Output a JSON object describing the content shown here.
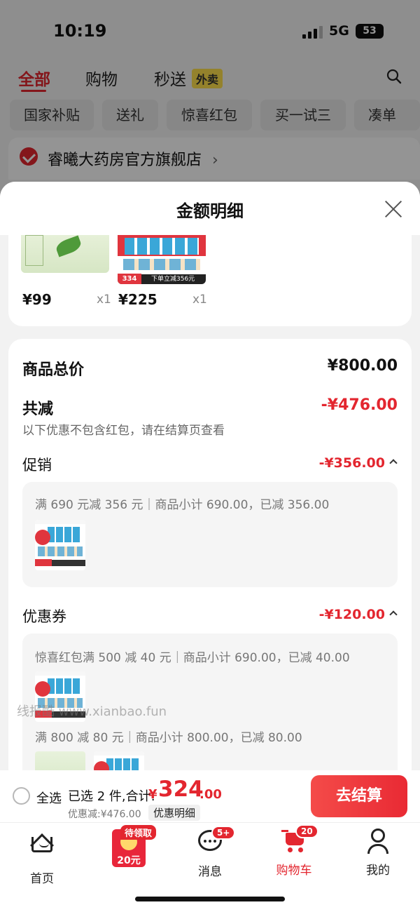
{
  "status_bar": {
    "time": "10:19",
    "network": "5G",
    "battery": "53"
  },
  "top_tabs": [
    {
      "label": "全部",
      "active": true
    },
    {
      "label": "购物",
      "active": false
    },
    {
      "label": "秒送",
      "active": false
    }
  ],
  "waimai_badge": "外卖",
  "filter_chips": [
    "国家补贴",
    "送礼",
    "惊喜红包",
    "买一试三",
    "凑单"
  ],
  "store": {
    "name": "睿曦大药房官方旗舰店",
    "chevron": "›"
  },
  "sheet": {
    "title": "金额明细",
    "products": [
      {
        "price": "¥99",
        "qty": "x1"
      },
      {
        "price": "¥225",
        "qty": "x1",
        "promo_badge": "334",
        "promo_text": "下单立减356元"
      }
    ],
    "total_label": "商品总价",
    "total_value": "¥800.00",
    "reduction_label": "共减",
    "reduction_value": "-¥476.00",
    "note": "以下优惠不包含红包，请在结算页查看",
    "promotion": {
      "label": "促销",
      "value": "-¥356.00",
      "items": [
        {
          "text": "满 690 元减 356 元｜商品小计 690.00，已减 356.00"
        }
      ]
    },
    "coupon": {
      "label": "优惠券",
      "value": "-¥120.00",
      "items": [
        {
          "text": "惊喜红包满 500 减 40 元｜商品小计 690.00，已减 40.00"
        },
        {
          "text": "满 800 减 80 元｜商品小计 800.00，已减 80.00"
        }
      ]
    }
  },
  "watermark": "线报酷 www.xianbao.fun",
  "bottom_bar": {
    "select_all": "全选",
    "selected_text": "已选 2 件,合计:",
    "total_symbol": "¥",
    "total_integer": "324",
    "total_decimal": ".00",
    "discount_text": "优惠减:¥476.00",
    "detail_button": "优惠明细",
    "checkout_button": "去结算"
  },
  "tab_bar": {
    "items": [
      {
        "label": "首页",
        "icon": "home-icon"
      },
      {
        "label": "消息",
        "icon": "message-icon",
        "badge": "5+"
      },
      {
        "label": "购物车",
        "icon": "cart-icon",
        "badge": "20",
        "active": true
      },
      {
        "label": "我的",
        "icon": "user-icon"
      }
    ],
    "red_packet": {
      "tag": "待领取",
      "amount": "20元"
    }
  },
  "colors": {
    "accent": "#e3262f",
    "text": "#1a1a1a",
    "muted": "#777777"
  }
}
